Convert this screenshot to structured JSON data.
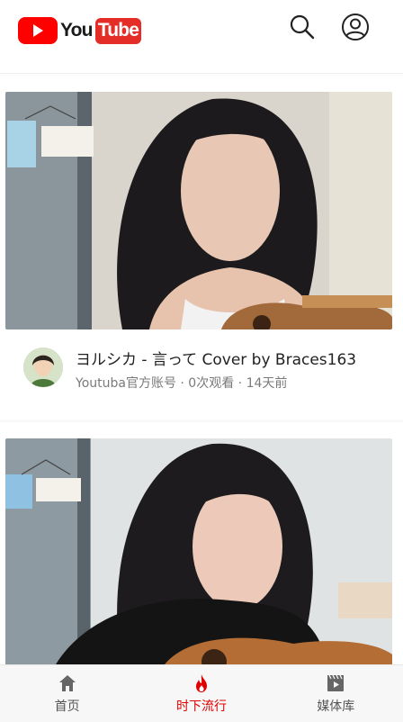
{
  "header": {
    "logo_you": "You",
    "logo_tube": "Tube",
    "search_icon": "search-icon",
    "account_icon": "account-circle-icon"
  },
  "videos": [
    {
      "title": "ヨルシカ - 言って Cover by Braces163",
      "subtitle": "Youtuba官方账号 · 0次观看 · 14天前"
    },
    {
      "title": "",
      "subtitle": ""
    }
  ],
  "bottom_nav": {
    "items": [
      {
        "label": "首页",
        "icon": "home-icon",
        "active": false
      },
      {
        "label": "时下流行",
        "icon": "fire-icon",
        "active": true
      },
      {
        "label": "媒体库",
        "icon": "library-icon",
        "active": false
      }
    ],
    "active_color": "#e00000",
    "inactive_color": "#555555"
  },
  "colors": {
    "brand_red": "#ff0000",
    "background": "#ffffff"
  }
}
